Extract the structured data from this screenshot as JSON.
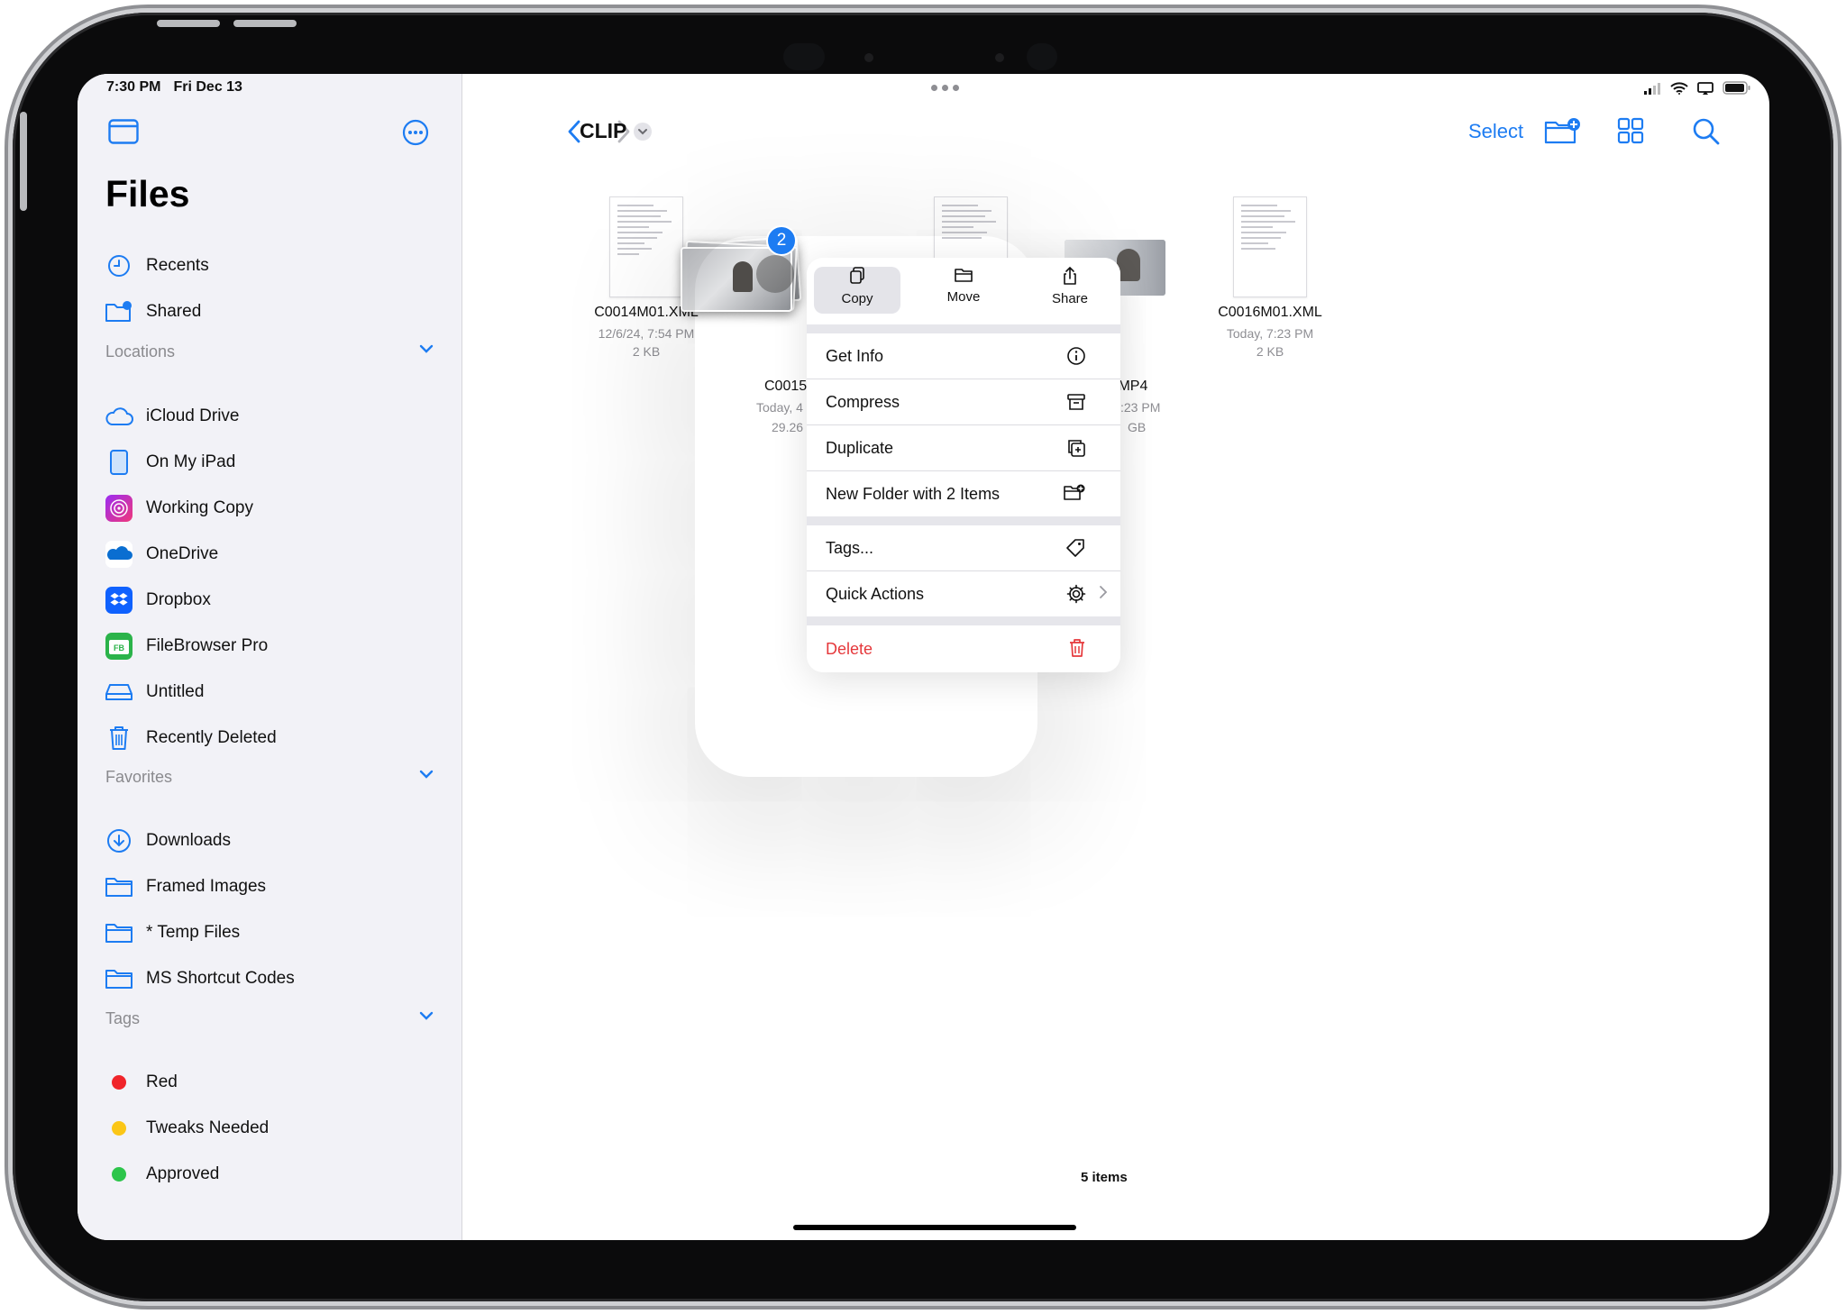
{
  "status": {
    "time": "7:30 PM",
    "date": "Fri Dec 13"
  },
  "sidebar": {
    "title": "Files",
    "top_items": [
      {
        "label": "Recents",
        "icon": "clock-icon"
      },
      {
        "label": "Shared",
        "icon": "shared-folder-icon"
      }
    ],
    "locations_header": "Locations",
    "locations": [
      {
        "label": "iCloud Drive",
        "icon": "cloud-icon"
      },
      {
        "label": "On My iPad",
        "icon": "ipad-icon"
      },
      {
        "label": "Working Copy",
        "icon": "working-copy-icon"
      },
      {
        "label": "OneDrive",
        "icon": "onedrive-icon"
      },
      {
        "label": "Dropbox",
        "icon": "dropbox-icon"
      },
      {
        "label": "FileBrowser Pro",
        "icon": "filebrowser-icon"
      },
      {
        "label": "Untitled",
        "icon": "drive-icon"
      },
      {
        "label": "Recently Deleted",
        "icon": "trash-icon"
      }
    ],
    "favorites_header": "Favorites",
    "favorites": [
      {
        "label": "Downloads",
        "icon": "download-icon"
      },
      {
        "label": "Framed Images",
        "icon": "folder-icon"
      },
      {
        "label": "* Temp Files",
        "icon": "folder-icon"
      },
      {
        "label": "MS Shortcut Codes",
        "icon": "folder-icon"
      }
    ],
    "tags_header": "Tags",
    "tags": [
      {
        "label": "Red",
        "color": "#f0242a"
      },
      {
        "label": "Tweaks Needed",
        "color": "#fbc617"
      },
      {
        "label": "Approved",
        "color": "#2dc54b"
      }
    ]
  },
  "toolbar": {
    "folder_title": "CLIP",
    "select_label": "Select"
  },
  "files": [
    {
      "name": "C0014M01.XML",
      "date": "12/6/24, 7:54 PM",
      "size": "2 KB"
    },
    {
      "name": "C0015",
      "date": "Today, 4",
      "size": "29.26"
    },
    {
      "name": ".MP4",
      "date": ":23 PM",
      "size": "GB"
    },
    {
      "name": "C0016M01.XML",
      "date": "Today, 7:23 PM",
      "size": "2 KB"
    }
  ],
  "selection_badge": "2",
  "context_menu": {
    "top_actions": [
      {
        "label": "Copy",
        "icon": "copy-icon"
      },
      {
        "label": "Move",
        "icon": "folder-icon"
      },
      {
        "label": "Share",
        "icon": "share-icon"
      }
    ],
    "group1": [
      {
        "label": "Get Info",
        "icon": "info-icon"
      },
      {
        "label": "Compress",
        "icon": "archive-icon"
      },
      {
        "label": "Duplicate",
        "icon": "duplicate-icon"
      },
      {
        "label": "New Folder with 2 Items",
        "icon": "new-folder-icon"
      }
    ],
    "group2": [
      {
        "label": "Tags...",
        "icon": "tag-icon"
      },
      {
        "label": "Quick Actions",
        "icon": "gear-icon"
      }
    ],
    "delete_label": "Delete",
    "delete_color": "#e5383b"
  },
  "footer": {
    "item_count": "5 items"
  },
  "colors": {
    "accent": "#1d7cf2"
  }
}
